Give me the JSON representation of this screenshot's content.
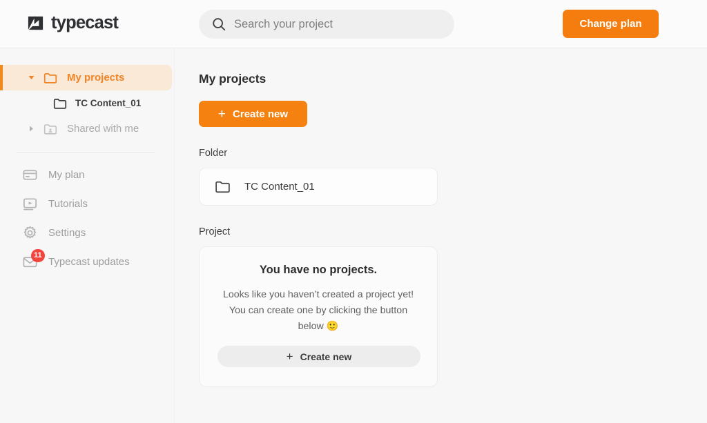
{
  "header": {
    "logo_text": "typecast",
    "logo_icon": "typecast-play-mark",
    "search": {
      "icon": "search-icon",
      "placeholder": "Search your project",
      "value": ""
    },
    "change_plan_label": "Change plan"
  },
  "sidebar": {
    "tree": [
      {
        "label": "My projects",
        "icon": "folder-icon",
        "caret": "caret-down-icon",
        "selected": true
      },
      {
        "label": "TC Content_01",
        "icon": "folder-icon",
        "selected": false
      },
      {
        "label": "Shared with me",
        "icon": "shared-folder-icon",
        "caret": "caret-right-icon",
        "selected": false
      }
    ],
    "menu": [
      {
        "label": "My plan",
        "icon": "card-icon"
      },
      {
        "label": "Tutorials",
        "icon": "monitor-play-icon"
      },
      {
        "label": "Settings",
        "icon": "gear-icon"
      },
      {
        "label": "Typecast updates",
        "icon": "envelope-icon",
        "badge": "11"
      }
    ]
  },
  "main": {
    "title": "My projects",
    "create_new_label": "Create new",
    "plus": "+",
    "folder_section_label": "Folder",
    "folder_item": {
      "icon": "folder-icon",
      "name": "TC Content_01"
    },
    "project_section_label": "Project",
    "empty_state": {
      "title": "You have no projects.",
      "description": "Looks like you haven’t created a project yet! You can create one by clicking the button below 🙂",
      "create_new_label": "Create new"
    }
  },
  "colors": {
    "accent_orange": "#f58111",
    "selected_bg": "#fbe9d8",
    "selected_text": "#ef8325",
    "badge_red": "#f2453d",
    "page_bg": "#f7f7f7"
  }
}
